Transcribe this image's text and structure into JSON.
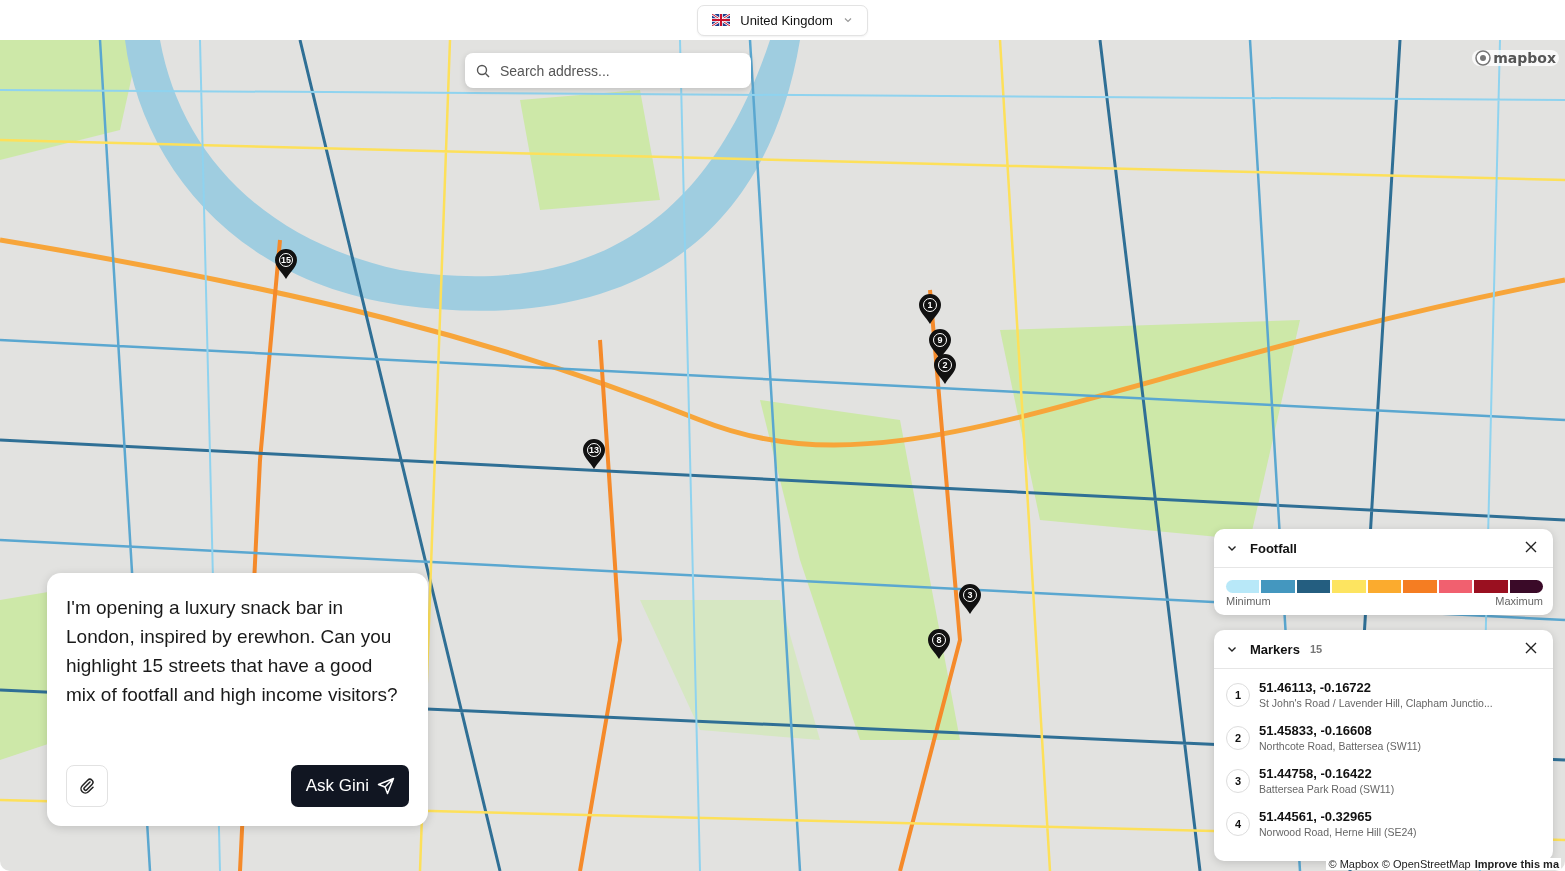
{
  "country_selector": {
    "label": "United Kingdom"
  },
  "search": {
    "placeholder": "Search address..."
  },
  "map": {
    "logo": "mapbox",
    "attribution": "© Mapbox © OpenStreetMap",
    "improve_link": "Improve this ma",
    "pins": [
      {
        "label": "15"
      },
      {
        "label": "1"
      },
      {
        "label": "9"
      },
      {
        "label": "2"
      },
      {
        "label": "13"
      },
      {
        "label": "3"
      },
      {
        "label": "8"
      }
    ]
  },
  "chat": {
    "prompt": "I'm opening a luxury snack bar in London, inspired by erewhon. Can you highlight 15 streets that have a good mix of footfall and high income visitors?",
    "submit": "Ask Gini"
  },
  "footfall_panel": {
    "title": "Footfall",
    "expanded": true,
    "min_label": "Minimum",
    "max_label": "Maximum",
    "scale": [
      {
        "color": "#b8e8f8"
      },
      {
        "color": "#4497bf"
      },
      {
        "color": "#245e80"
      },
      {
        "color": "#fde460"
      },
      {
        "color": "#fbab2e"
      },
      {
        "color": "#f57d22"
      },
      {
        "color": "#f1606f"
      },
      {
        "color": "#9a1020"
      },
      {
        "color": "#3a0a28"
      }
    ]
  },
  "markers_panel": {
    "title": "Markers",
    "count": "15",
    "expanded": true,
    "items": [
      {
        "number": "1",
        "coords": "51.46113, -0.16722",
        "address": "St John's Road / Lavender Hill, Clapham Junctio..."
      },
      {
        "number": "2",
        "coords": "51.45833, -0.16608",
        "address": "Northcote Road, Battersea (SW11)"
      },
      {
        "number": "3",
        "coords": "51.44758, -0.16422",
        "address": "Battersea Park Road (SW11)"
      },
      {
        "number": "4",
        "coords": "51.44561, -0.32965",
        "address": "Norwood Road, Herne Hill (SE24)"
      }
    ]
  }
}
